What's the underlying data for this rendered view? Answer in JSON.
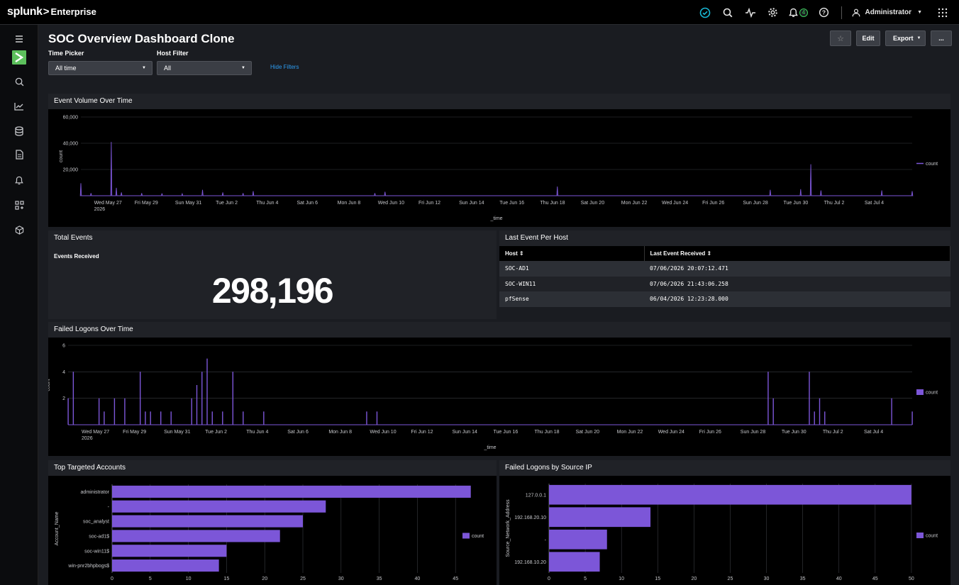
{
  "topbar": {
    "logo_brand": "splunk",
    "logo_chevron": ">",
    "logo_product": "Enterprise",
    "icons": [
      "health-check-icon",
      "search-icon",
      "activity-icon",
      "gear-icon",
      "bell-icon",
      "help-icon"
    ],
    "notification_count": "4",
    "user_label": "Administrator"
  },
  "sidebar": {
    "icons": [
      "menu-icon",
      "app-logo-icon",
      "search-icon",
      "chart-icon",
      "datasets-icon",
      "document-icon",
      "bell-icon",
      "apps-icon",
      "package-icon"
    ]
  },
  "dashboard": {
    "title": "SOC Overview Dashboard Clone",
    "buttons": {
      "star": "☆",
      "edit": "Edit",
      "export": "Export",
      "more": "..."
    },
    "filters": {
      "time_label": "Time Picker",
      "time_value": "All time",
      "host_label": "Host Filter",
      "host_value": "All",
      "hide_link": "Hide Filters"
    }
  },
  "panels": {
    "event_volume": "Event Volume Over Time",
    "total_events": "Total Events",
    "events_received_label": "Events Received",
    "events_received_value": "298,196",
    "last_event": "Last Event Per Host",
    "failed_logons_time": "Failed Logons Over Time",
    "top_accounts": "Top Targeted Accounts",
    "failed_by_ip": "Failed Logons by Source IP"
  },
  "hosts_table": {
    "headers": [
      "Host ⇕",
      "Last Event Received ⇕"
    ],
    "rows": [
      [
        "SOC-AD1",
        "07/06/2026 20:07:12.471"
      ],
      [
        "SOC-WIN11",
        "07/06/2026 21:43:06.258"
      ],
      [
        "pfSense",
        "06/04/2026 12:23:28.000"
      ]
    ]
  },
  "colors": {
    "series": "#7c56d8",
    "panel_bg": "#000000",
    "header_bg": "#202227"
  },
  "chart_data": [
    {
      "id": "event_volume",
      "type": "area",
      "xlabel": "_time",
      "ylabel": "count",
      "ylim": [
        0,
        60000
      ],
      "yticks": [
        "20,000",
        "40,000",
        "60,000"
      ],
      "xticks": [
        "Wed May 27",
        "Fri May 29",
        "Sun May 31",
        "Tue Jun 2",
        "Thu Jun 4",
        "Sat Jun 6",
        "Mon Jun 8",
        "Wed Jun 10",
        "Fri Jun 12",
        "Sun Jun 14",
        "Tue Jun 16",
        "Thu Jun 18",
        "Sat Jun 20",
        "Mon Jun 22",
        "Wed Jun 24",
        "Fri Jun 26",
        "Sun Jun 28",
        "Tue Jun 30",
        "Thu Jul 2",
        "Sat Jul 4"
      ],
      "xtick_year": "2026",
      "legend": "count",
      "legend_position": "right",
      "x_start": "May 26 2026",
      "x_end": "Jul 6 2026",
      "series": [
        {
          "name": "count",
          "points": [
            [
              "May 26",
              9500
            ],
            [
              "May 26 12h",
              2000
            ],
            [
              "May 27 12h",
              41000
            ],
            [
              "May 27 18h",
              6000
            ],
            [
              "May 28",
              2500
            ],
            [
              "May 29",
              2000
            ],
            [
              "May 30",
              1800
            ],
            [
              "May 31",
              1500
            ],
            [
              "Jun 1",
              4500
            ],
            [
              "Jun 2",
              2500
            ],
            [
              "Jun 3",
              2000
            ],
            [
              "Jun 3 12h",
              3500
            ],
            [
              "Jun 9 12h",
              2000
            ],
            [
              "Jun 10",
              3000
            ],
            [
              "Jun 18 12h",
              7000
            ],
            [
              "Jun 29",
              4500
            ],
            [
              "Jun 30 12h",
              5000
            ],
            [
              "Jul 1",
              24000
            ],
            [
              "Jul 1 12h",
              4000
            ],
            [
              "Jul 4 12h",
              4000
            ],
            [
              "Jul 6",
              3500
            ]
          ]
        }
      ]
    },
    {
      "id": "failed_logons_time",
      "type": "bar",
      "xlabel": "_time",
      "ylabel": "count",
      "ylim": [
        0,
        6
      ],
      "yticks": [
        "2",
        "4",
        "6"
      ],
      "xticks": [
        "Wed May 27",
        "Fri May 29",
        "Sun May 31",
        "Tue Jun 2",
        "Thu Jun 4",
        "Sat Jun 6",
        "Mon Jun 8",
        "Wed Jun 10",
        "Fri Jun 12",
        "Sun Jun 14",
        "Tue Jun 16",
        "Thu Jun 18",
        "Sat Jun 20",
        "Mon Jun 22",
        "Wed Jun 24",
        "Fri Jun 26",
        "Sun Jun 28",
        "Tue Jun 30",
        "Thu Jul 2",
        "Sat Jul 4"
      ],
      "xtick_year": "2026",
      "legend": "count",
      "legend_position": "right",
      "series": [
        {
          "name": "count",
          "points": [
            [
              "May 26",
              2
            ],
            [
              "May 26 6h",
              4
            ],
            [
              "May 27 12h",
              2
            ],
            [
              "May 27 18h",
              1
            ],
            [
              "May 28 6h",
              2
            ],
            [
              "May 28 18h",
              2
            ],
            [
              "May 29 12h",
              4
            ],
            [
              "May 29 18h",
              1
            ],
            [
              "May 30",
              1
            ],
            [
              "May 30 12h",
              1
            ],
            [
              "May 31",
              1
            ],
            [
              "Jun 1",
              2
            ],
            [
              "Jun 1 6h",
              3
            ],
            [
              "Jun 1 12h",
              4
            ],
            [
              "Jun 1 18h",
              5
            ],
            [
              "Jun 2",
              1
            ],
            [
              "Jun 2 12h",
              1
            ],
            [
              "Jun 3",
              4
            ],
            [
              "Jun 3 12h",
              1
            ],
            [
              "Jun 4 12h",
              1
            ],
            [
              "Jun 9 12h",
              1
            ],
            [
              "Jun 10",
              1
            ],
            [
              "Jun 29",
              4
            ],
            [
              "Jun 29 6h",
              2
            ],
            [
              "Jul 1",
              4
            ],
            [
              "Jul 1 6h",
              1
            ],
            [
              "Jul 1 12h",
              2
            ],
            [
              "Jul 1 18h",
              1
            ],
            [
              "Jul 5",
              2
            ],
            [
              "Jul 6",
              1
            ]
          ]
        }
      ]
    },
    {
      "id": "top_accounts",
      "type": "bar",
      "orientation": "horizontal",
      "xlabel": "count",
      "ylabel": "Account_Name",
      "xlim": [
        0,
        50
      ],
      "xticks": [
        "0",
        "5",
        "10",
        "15",
        "20",
        "25",
        "30",
        "35",
        "40",
        "45"
      ],
      "legend": "count",
      "legend_position": "right",
      "categories": [
        "administrator",
        "-",
        "soc_analyst",
        "soc-ad1$",
        "soc-win11$",
        "win-pnr2bhpbogs$"
      ],
      "values": [
        47,
        28,
        25,
        22,
        15,
        14
      ]
    },
    {
      "id": "failed_by_ip",
      "type": "bar",
      "orientation": "horizontal",
      "xlabel": "count",
      "ylabel": "Source_Network_Address",
      "xlim": [
        0,
        55
      ],
      "xticks": [
        "0",
        "5",
        "10",
        "15",
        "20",
        "25",
        "30",
        "35",
        "40",
        "45",
        "50"
      ],
      "legend": "count",
      "legend_position": "right",
      "categories": [
        "127.0.0.1",
        "192.168.20.10",
        "-",
        "192.168.10.20"
      ],
      "values": [
        50,
        14,
        8,
        7
      ]
    }
  ]
}
